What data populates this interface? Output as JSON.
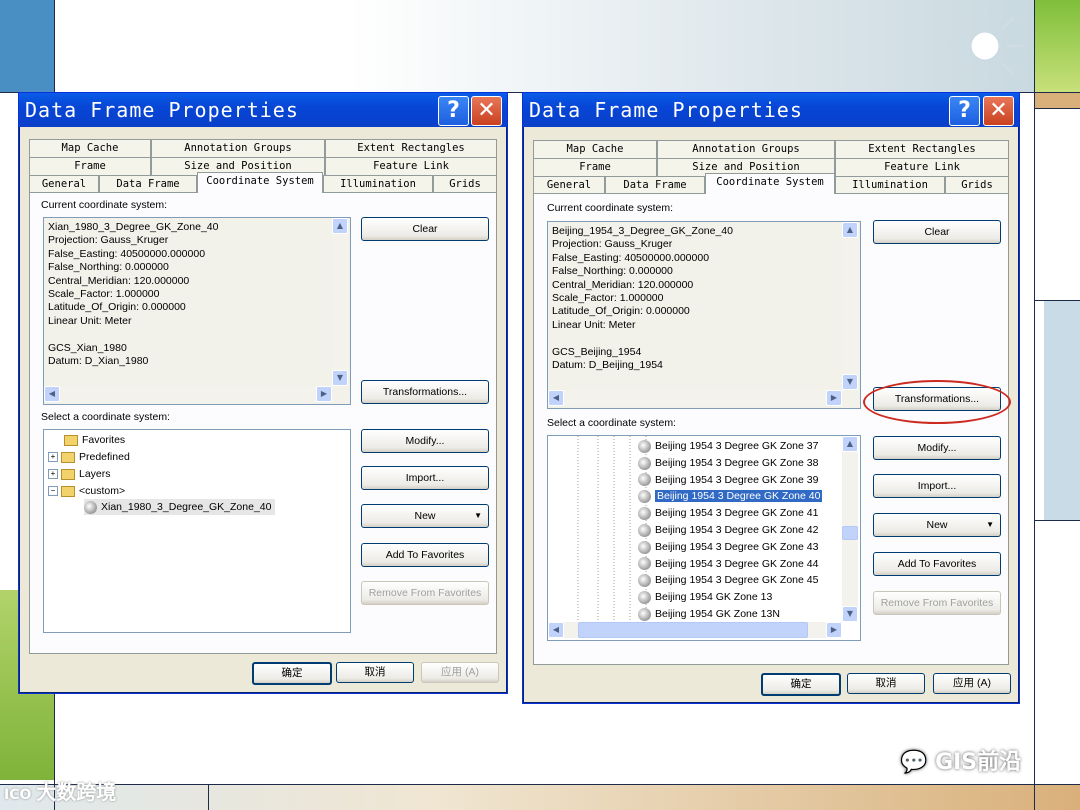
{
  "colors": {
    "titlebar": "#0a4ee0",
    "dialog_bg": "#ece9d8",
    "selection": "#316ac5",
    "highlight_circle": "#cc2a1e"
  },
  "left_dialog": {
    "title": "Data Frame Properties",
    "tabs_row1": [
      "Map Cache",
      "Annotation Groups",
      "Extent Rectangles"
    ],
    "tabs_row2": [
      "Frame",
      "Size and Position",
      "Feature Link"
    ],
    "tabs_row3": [
      "General",
      "Data Frame",
      "Coordinate System",
      "Illumination",
      "Grids"
    ],
    "current_label": "Current coordinate system:",
    "current_text": "Xian_1980_3_Degree_GK_Zone_40\nProjection: Gauss_Kruger\nFalse_Easting: 40500000.000000\nFalse_Northing: 0.000000\nCentral_Meridian: 120.000000\nScale_Factor: 1.000000\nLatitude_Of_Origin: 0.000000\nLinear Unit: Meter\n\nGCS_Xian_1980\nDatum: D_Xian_1980",
    "select_label": "Select a coordinate system:",
    "tree": [
      "Favorites",
      "Predefined",
      "Layers",
      "<custom>",
      "Xian_1980_3_Degree_GK_Zone_40"
    ],
    "buttons": {
      "clear": "Clear",
      "transformations": "Transformations...",
      "modify": "Modify...",
      "import": "Import...",
      "new": "New",
      "add_fav": "Add To Favorites",
      "remove_fav": "Remove From Favorites"
    },
    "footer": {
      "ok": "确定",
      "cancel": "取消",
      "apply": "应用 (A)"
    }
  },
  "right_dialog": {
    "title": "Data Frame Properties",
    "tabs_row1": [
      "Map Cache",
      "Annotation Groups",
      "Extent Rectangles"
    ],
    "tabs_row2": [
      "Frame",
      "Size and Position",
      "Feature Link"
    ],
    "tabs_row3": [
      "General",
      "Data Frame",
      "Coordinate System",
      "Illumination",
      "Grids"
    ],
    "current_label": "Current coordinate system:",
    "current_text": "Beijing_1954_3_Degree_GK_Zone_40\nProjection: Gauss_Kruger\nFalse_Easting: 40500000.000000\nFalse_Northing: 0.000000\nCentral_Meridian: 120.000000\nScale_Factor: 1.000000\nLatitude_Of_Origin: 0.000000\nLinear Unit: Meter\n\nGCS_Beijing_1954\nDatum: D_Beijing_1954",
    "select_label": "Select a coordinate system:",
    "list": [
      "Beijing 1954 3 Degree GK Zone 37",
      "Beijing 1954 3 Degree GK Zone 38",
      "Beijing 1954 3 Degree GK Zone 39",
      "Beijing 1954 3 Degree GK Zone 40",
      "Beijing 1954 3 Degree GK Zone 41",
      "Beijing 1954 3 Degree GK Zone 42",
      "Beijing 1954 3 Degree GK Zone 43",
      "Beijing 1954 3 Degree GK Zone 44",
      "Beijing 1954 3 Degree GK Zone 45",
      "Beijing 1954 GK Zone 13",
      "Beijing 1954 GK Zone 13N"
    ],
    "selected_index": 3,
    "buttons": {
      "clear": "Clear",
      "transformations": "Transformations...",
      "modify": "Modify...",
      "import": "Import...",
      "new": "New",
      "add_fav": "Add To Favorites",
      "remove_fav": "Remove From Favorites"
    },
    "footer": {
      "ok": "确定",
      "cancel": "取消",
      "apply": "应用 (A)"
    }
  },
  "watermarks": {
    "left": "大数跨境",
    "right": "GIS前沿"
  }
}
